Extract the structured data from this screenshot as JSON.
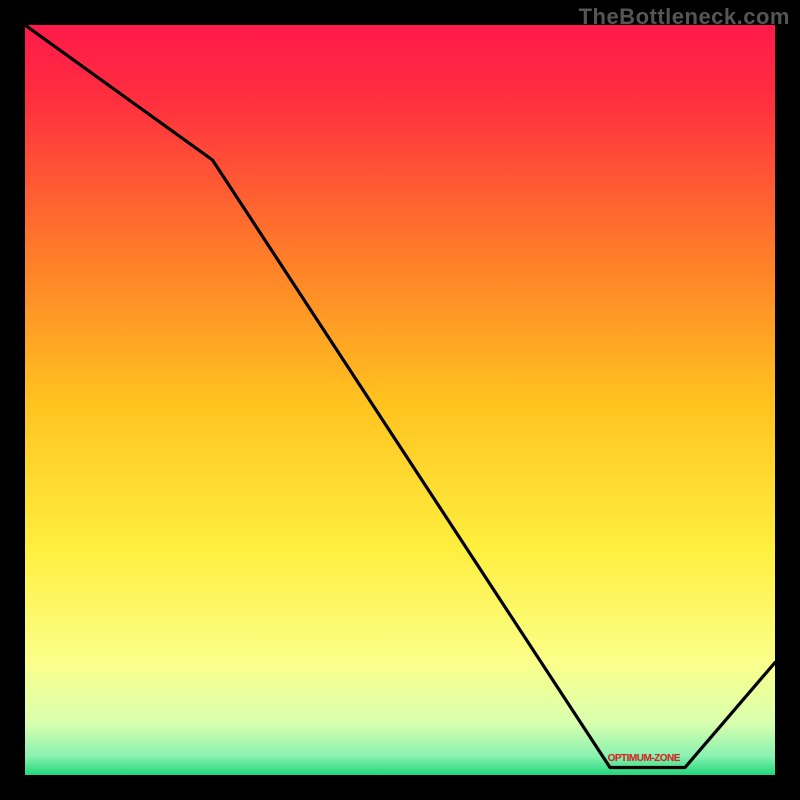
{
  "watermark": "TheBottleneck.com",
  "annotation": {
    "label": "OPTIMUM-ZONE",
    "x_frac": 0.825
  },
  "chart_data": {
    "type": "line",
    "title": "",
    "xlabel": "",
    "ylabel": "",
    "xlim": [
      0,
      1
    ],
    "ylim": [
      0,
      1
    ],
    "x": [
      0.0,
      0.25,
      0.78,
      0.88,
      1.0
    ],
    "values": [
      1.0,
      0.82,
      0.01,
      0.01,
      0.15
    ],
    "optimum_band": {
      "start": 0.77,
      "end": 0.88
    },
    "gradient_stops": [
      {
        "offset": 0.0,
        "color": "#ff1a4a"
      },
      {
        "offset": 0.1,
        "color": "#ff2f3f"
      },
      {
        "offset": 0.3,
        "color": "#ff7a2a"
      },
      {
        "offset": 0.5,
        "color": "#ffc21f"
      },
      {
        "offset": 0.7,
        "color": "#ffef3f"
      },
      {
        "offset": 0.85,
        "color": "#fbff8a"
      },
      {
        "offset": 0.93,
        "color": "#d9ffae"
      },
      {
        "offset": 0.975,
        "color": "#8af2b2"
      },
      {
        "offset": 1.0,
        "color": "#22d67a"
      }
    ]
  }
}
